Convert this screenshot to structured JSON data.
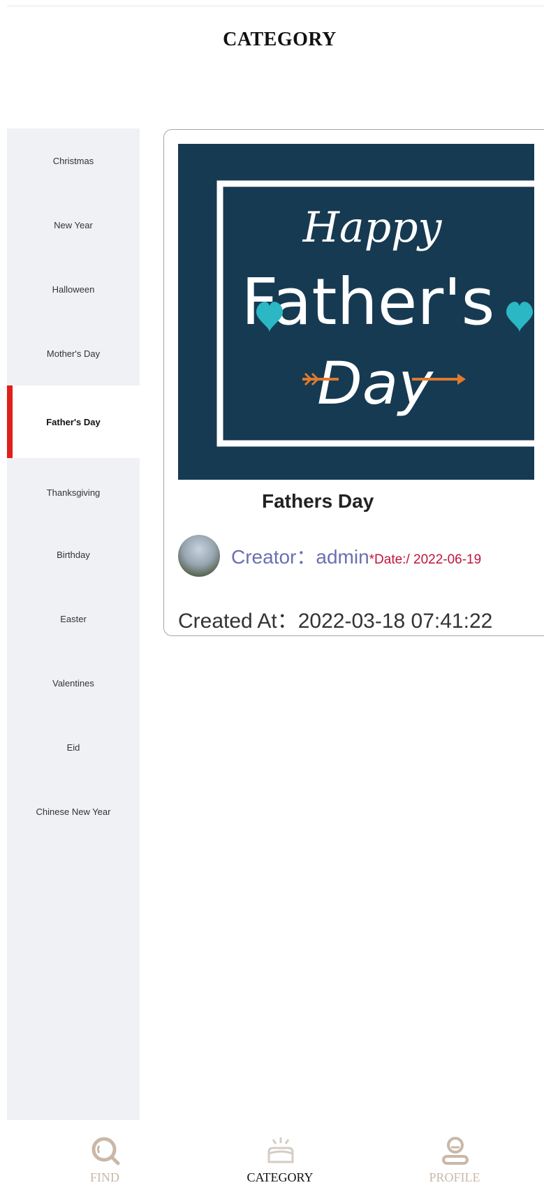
{
  "header": {
    "title": "CATEGORY"
  },
  "sidebar": {
    "items": [
      {
        "label": "Christmas",
        "active": false
      },
      {
        "label": "New Year",
        "active": false
      },
      {
        "label": "Halloween",
        "active": false
      },
      {
        "label": "Mother's Day",
        "active": false
      },
      {
        "label": "Father's Day",
        "active": true
      },
      {
        "label": "Thanksgiving",
        "active": false
      },
      {
        "label": "Birthday",
        "active": false
      },
      {
        "label": "Easter",
        "active": false
      },
      {
        "label": "Valentines",
        "active": false
      },
      {
        "label": "Eid",
        "active": false
      },
      {
        "label": "Chinese New Year",
        "active": false
      }
    ]
  },
  "card": {
    "image_text": {
      "line1": "Happy",
      "line2": "Father's",
      "line3": "Day"
    },
    "name": "Fathers Day",
    "creator_label": "Creator：",
    "creator_name": "admin",
    "date_text": "*Date:/ 2022-06-19",
    "created_at": "Created At：2022-03-18 07:41:22"
  },
  "tabbar": {
    "tabs": [
      {
        "label": "FIND",
        "icon": "search-icon",
        "active": false
      },
      {
        "label": "CATEGORY",
        "icon": "category-icon",
        "active": true
      },
      {
        "label": "PROFILE",
        "icon": "profile-icon",
        "active": false
      }
    ]
  },
  "colors": {
    "accent_red": "#e0201a",
    "image_bg": "#163a52",
    "heart_teal": "#2bb7c3",
    "arrow_orange": "#e07a2e",
    "creator_blue": "#6b6fb3",
    "date_red": "#c0143c",
    "tab_inactive": "#c9b8a8"
  }
}
